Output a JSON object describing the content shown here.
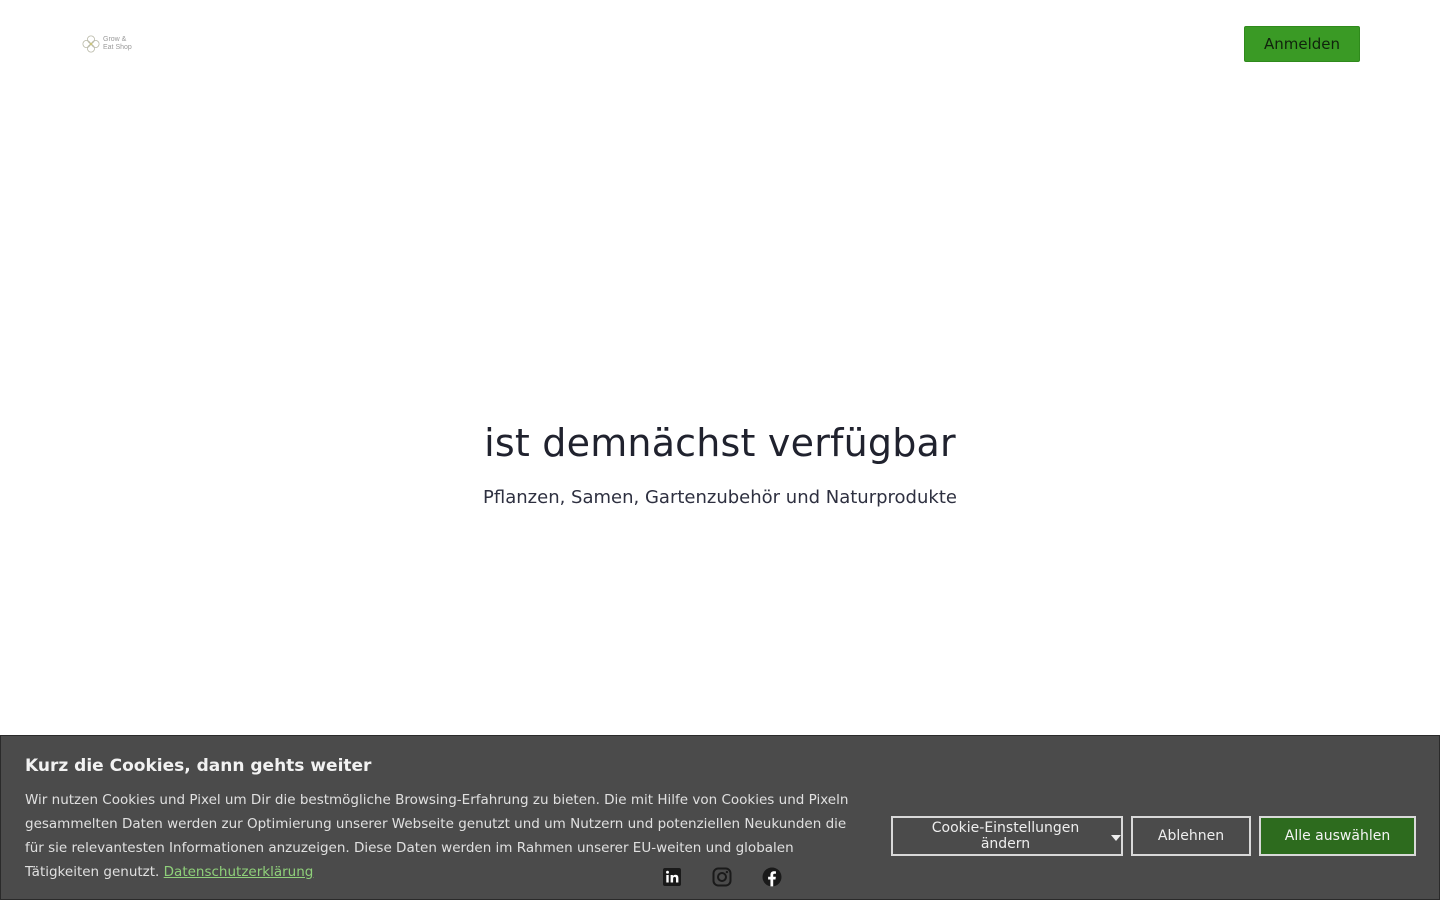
{
  "header": {
    "logo_line1": "Grow &",
    "logo_line2": "Eat Shop",
    "login_label": "Anmelden"
  },
  "hero": {
    "title": "ist demnächst verfügbar",
    "subtitle": "Pflanzen, Samen, Gartenzubehör und Naturprodukte"
  },
  "social": {
    "icons": [
      "linkedin-icon",
      "instagram-icon",
      "facebook-icon"
    ]
  },
  "cookie": {
    "title": "Kurz die Cookies, dann gehts weiter",
    "text": "Wir nutzen Cookies und Pixel um Dir die bestmögliche Browsing-Erfahrung zu bieten. Die mit Hilfe von Cookies und Pixeln gesammelten Daten werden zur Optimierung unserer Webseite genutzt und um Nutzern und potenziellen Neukunden die für sie relevantesten Informationen anzuzeigen. Diese Daten werden im Rahmen unserer EU-weiten und globalen Tätigkeiten genutzt.",
    "privacy_link": "Datenschutzerklärung",
    "settings_label": "Cookie-Einstellungen ändern",
    "decline_label": "Ablehnen",
    "accept_label": "Alle auswählen"
  },
  "colors": {
    "primary_green": "#3a9a25",
    "accept_green": "#2d6b1e",
    "banner_bg": "#404040",
    "link_green": "#8fd07a"
  }
}
